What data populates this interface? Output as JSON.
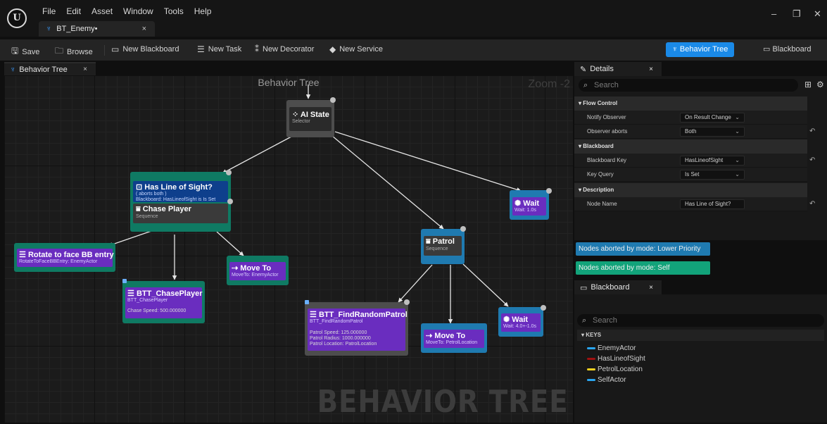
{
  "menu": [
    "File",
    "Edit",
    "Asset",
    "Window",
    "Tools",
    "Help"
  ],
  "doc_tab": {
    "label": "BT_Enemy•",
    "close": "×"
  },
  "window_controls": {
    "minimize": "–",
    "restore": "❐",
    "close": "✕"
  },
  "toolbar": {
    "save": "Save",
    "browse": "Browse",
    "new_blackboard": "New Blackboard",
    "new_task": "New Task",
    "new_decorator": "New Decorator",
    "new_service": "New Service",
    "mode_behavior_tree": "Behavior Tree",
    "mode_blackboard": "Blackboard"
  },
  "graph": {
    "tab_label": "Behavior Tree",
    "title": "Behavior Tree",
    "zoom": "Zoom -2",
    "watermark": "BEHAVIOR TREE"
  },
  "nodes": {
    "root": {
      "title": "AI State",
      "sub": "Selector"
    },
    "has_los": {
      "title": "Has Line of Sight?",
      "l1": "( aborts both )",
      "l2": "Blackboard: HasLineofSight is Is Set"
    },
    "chase": {
      "title": "Chase Player",
      "sub": "Sequence"
    },
    "wait1": {
      "title": "Wait",
      "sub": "Wait: 1.0s"
    },
    "rotate": {
      "title": "Rotate to face BB entry",
      "sub": "RotateToFaceBBEntry: EnemyActor"
    },
    "moveto1": {
      "title": "Move To",
      "sub": "MoveTo: EnemyActor"
    },
    "btt_chase": {
      "title": "BTT_ChasePlayer",
      "sub": "BTT_ChasePlayer",
      "l1": "Chase Speed: 500.000000"
    },
    "patrol": {
      "title": "Patrol",
      "sub": "Sequence"
    },
    "btt_find": {
      "title": "BTT_FindRandomPatrol",
      "sub": "BTT_FindRandomPatrol",
      "l1": "Patrol Speed: 125.000000",
      "l2": "Patrol Radius: 1000.000000",
      "l3": "Patrol Location: PatrolLocation"
    },
    "moveto2": {
      "title": "Move To",
      "sub": "MoveTo: PetrolLocation"
    },
    "wait2": {
      "title": "Wait",
      "sub": "Wait: 4.0+-1.0s"
    }
  },
  "details": {
    "tab_label": "Details",
    "search_placeholder": "Search",
    "sections": {
      "flow_control": "Flow Control",
      "blackboard": "Blackboard",
      "description": "Description"
    },
    "rows": {
      "notify_observer": {
        "key": "Notify Observer",
        "value": "On Result Change"
      },
      "observer_aborts": {
        "key": "Observer aborts",
        "value": "Both"
      },
      "blackboard_key": {
        "key": "Blackboard Key",
        "value": "HasLineofSight"
      },
      "key_query": {
        "key": "Key Query",
        "value": "Is Set"
      },
      "node_name": {
        "key": "Node Name",
        "value": "Has Line of Sight?"
      }
    }
  },
  "legend": {
    "lower_priority": "Nodes aborted by mode: Lower Priority",
    "self": "Nodes aborted by mode: Self"
  },
  "blackboard_panel": {
    "tab_label": "Blackboard",
    "search_placeholder": "Search",
    "keys_header": "KEYS",
    "keys": [
      {
        "name": "EnemyActor",
        "color": "#2aa6f0"
      },
      {
        "name": "HasLineofSight",
        "color": "#a01010"
      },
      {
        "name": "PetrolLocation",
        "color": "#f0d020"
      },
      {
        "name": "SelfActor",
        "color": "#2aa6f0"
      }
    ]
  },
  "colors": {
    "accent": "#1a8ae8",
    "decorator": "#0e3f8c",
    "task": "#6a2dbf",
    "lower_priority": "#1f7ab0",
    "self": "#12a37a"
  }
}
